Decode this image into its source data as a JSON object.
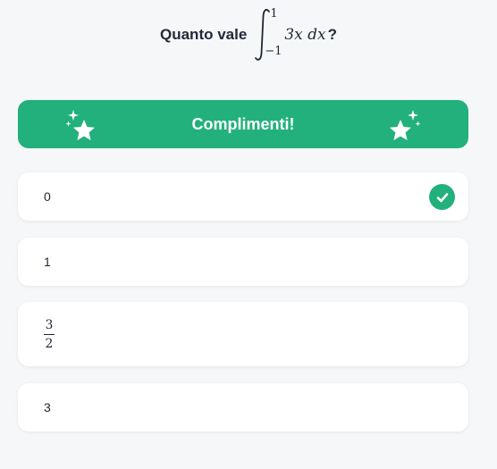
{
  "question": {
    "prefix": "Quanto vale",
    "integral_sign": "∫",
    "upper_limit": "1",
    "lower_limit": "−1",
    "integrand": "3x dx",
    "suffix": "?"
  },
  "banner": {
    "label": "Complimenti!",
    "icon": "sparkle-stars-icon"
  },
  "options": [
    {
      "label": "0",
      "selected": true,
      "correct": true
    },
    {
      "label": "1"
    },
    {
      "numerator": "3",
      "denominator": "2"
    },
    {
      "label": "3"
    }
  ],
  "colors": {
    "accent": "#22b07d",
    "background": "#f6f7f9",
    "card": "#ffffff",
    "text": "#1f2533"
  }
}
